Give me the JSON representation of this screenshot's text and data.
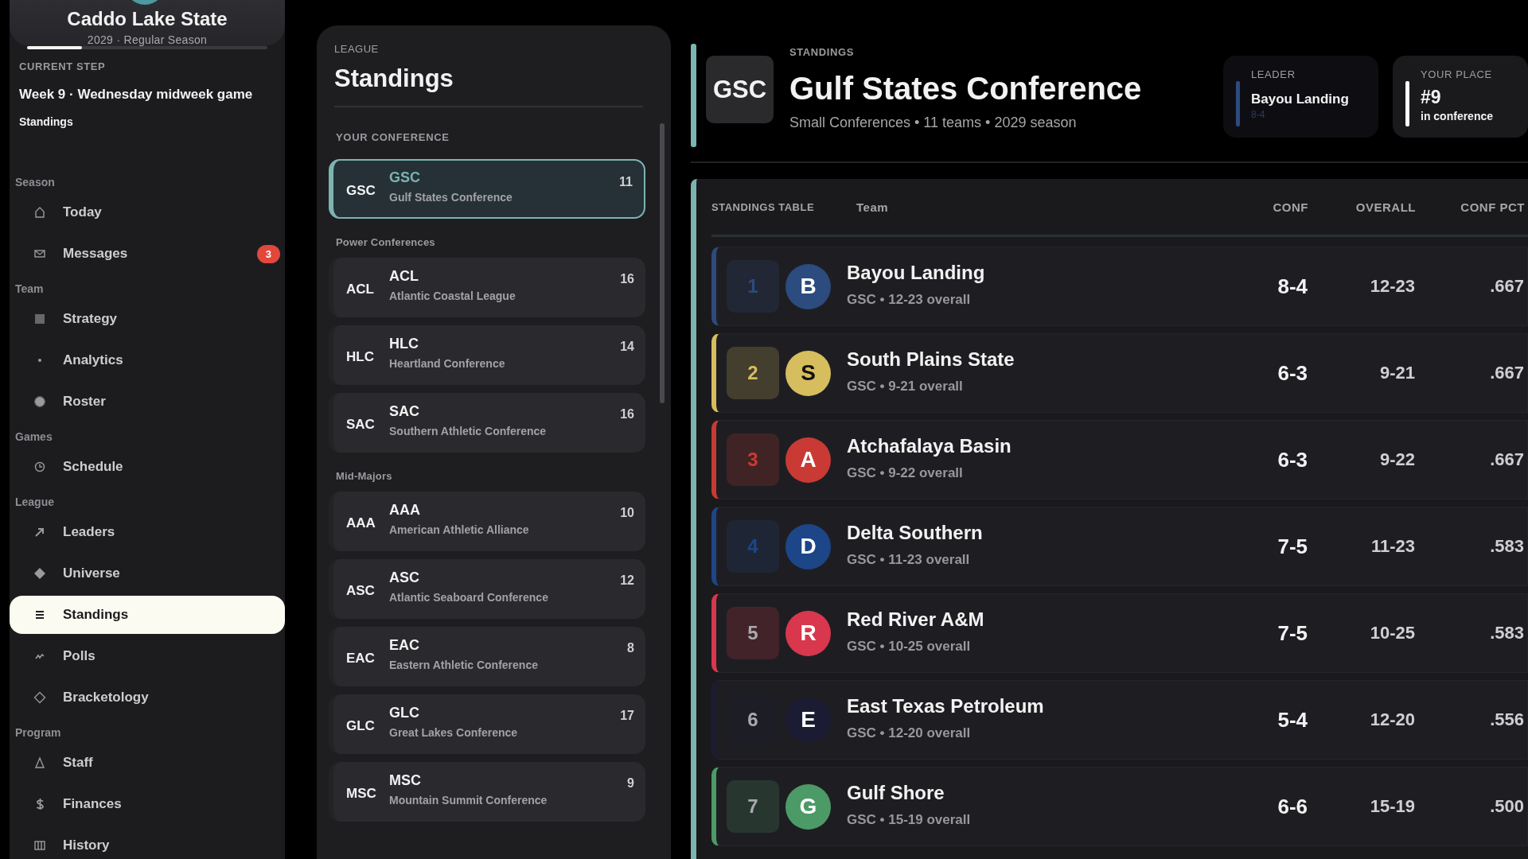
{
  "sidebar": {
    "team_name": "Caddo Lake State",
    "season_line": "2029 · Regular Season",
    "progress": {
      "level": 0.23
    },
    "current_step": {
      "label": "CURRENT STEP",
      "title": "Week 9 · Wednesday midweek game",
      "subtitle": "Standings"
    },
    "groups": [
      {
        "heading": "Season",
        "items": [
          {
            "label": "Today",
            "selected": false
          },
          {
            "label": "Messages",
            "selected": false,
            "badge": "3"
          }
        ]
      },
      {
        "heading": "Team",
        "items": [
          {
            "label": "Strategy",
            "selected": false
          },
          {
            "label": "Analytics",
            "selected": false
          },
          {
            "label": "Roster",
            "selected": false
          }
        ]
      },
      {
        "heading": "Games",
        "items": [
          {
            "label": "Schedule",
            "selected": false
          }
        ]
      },
      {
        "heading": "League",
        "items": [
          {
            "label": "Leaders",
            "selected": false
          },
          {
            "label": "Universe",
            "selected": false
          },
          {
            "label": "Standings",
            "selected": true
          },
          {
            "label": "Polls",
            "selected": false
          },
          {
            "label": "Bracketology",
            "selected": false
          }
        ]
      },
      {
        "heading": "Program",
        "items": [
          {
            "label": "Staff",
            "selected": false
          },
          {
            "label": "Finances",
            "selected": false
          },
          {
            "label": "History",
            "selected": false
          }
        ]
      }
    ]
  },
  "league_panel": {
    "section_label": "LEAGUE",
    "title": "Standings",
    "groups": [
      {
        "heading": "YOUR CONFERENCE",
        "conferences": [
          {
            "abbr": "GSC",
            "name": "GSC",
            "full_name": "Gulf States Conference",
            "teams": "11",
            "selected": true
          }
        ]
      },
      {
        "heading": "Power Conferences",
        "conferences": [
          {
            "abbr": "ACL",
            "name": "ACL",
            "full_name": "Atlantic Coastal League",
            "teams": "16",
            "selected": false
          },
          {
            "abbr": "HLC",
            "name": "HLC",
            "full_name": "Heartland Conference",
            "teams": "14",
            "selected": false
          },
          {
            "abbr": "SAC",
            "name": "SAC",
            "full_name": "Southern Athletic Conference",
            "teams": "16",
            "selected": false
          }
        ]
      },
      {
        "heading": "Mid-Majors",
        "conferences": [
          {
            "abbr": "AAA",
            "name": "AAA",
            "full_name": "American Athletic Alliance",
            "teams": "10",
            "selected": false
          },
          {
            "abbr": "ASC",
            "name": "ASC",
            "full_name": "Atlantic Seaboard Conference",
            "teams": "12",
            "selected": false
          },
          {
            "abbr": "EAC",
            "name": "EAC",
            "full_name": "Eastern Athletic Conference",
            "teams": "8",
            "selected": false
          },
          {
            "abbr": "GLC",
            "name": "GLC",
            "full_name": "Great Lakes Conference",
            "teams": "17",
            "selected": false
          },
          {
            "abbr": "MSC",
            "name": "MSC",
            "full_name": "Mountain Summit Conference",
            "teams": "9",
            "selected": false
          }
        ]
      }
    ]
  },
  "header": {
    "eyebrow": "STANDINGS",
    "logo": "GSC",
    "title": "Gulf States Conference",
    "meta": "Small Conferences • 11 teams • 2029 season",
    "leader": {
      "label": "LEADER",
      "team": "Bayou Landing",
      "record": "8-4"
    },
    "your_place": {
      "label": "YOUR PLACE",
      "value": "#9",
      "note": "in conference"
    }
  },
  "table": {
    "label": "STANDINGS TABLE",
    "columns": [
      "Team",
      "CONF",
      "OVERALL",
      "CONF PCT"
    ],
    "rows": [
      {
        "rank": "1",
        "initial": "B",
        "team": "Bayou Landing",
        "detail": "GSC • 12-23 overall",
        "conf": "8-4",
        "overall": "12-23",
        "pct": ".667",
        "color": "#2c4b7e",
        "seeded": true
      },
      {
        "rank": "2",
        "initial": "S",
        "team": "South Plains State",
        "detail": "GSC • 9-21 overall",
        "conf": "6-3",
        "overall": "9-21",
        "pct": ".667",
        "color": "#d6bd5e",
        "seeded": true
      },
      {
        "rank": "3",
        "initial": "A",
        "team": "Atchafalaya Basin",
        "detail": "GSC • 9-22 overall",
        "conf": "6-3",
        "overall": "9-22",
        "pct": ".667",
        "color": "#c93a34",
        "seeded": true
      },
      {
        "rank": "4",
        "initial": "D",
        "team": "Delta Southern",
        "detail": "GSC • 11-23 overall",
        "conf": "7-5",
        "overall": "11-23",
        "pct": ".583",
        "color": "#1d4688",
        "seeded": true
      },
      {
        "rank": "5",
        "initial": "R",
        "team": "Red River A&M",
        "detail": "GSC • 10-25 overall",
        "conf": "7-5",
        "overall": "10-25",
        "pct": ".583",
        "color": "#d8374d",
        "seeded": false
      },
      {
        "rank": "6",
        "initial": "E",
        "team": "East Texas Petroleum",
        "detail": "GSC • 12-20 overall",
        "conf": "5-4",
        "overall": "12-20",
        "pct": ".556",
        "color": "#1b1c34",
        "seeded": false
      },
      {
        "rank": "7",
        "initial": "G",
        "team": "Gulf Shore",
        "detail": "GSC • 15-19 overall",
        "conf": "6-6",
        "overall": "15-19",
        "pct": ".500",
        "color": "#4c9a66",
        "seeded": false
      }
    ]
  }
}
